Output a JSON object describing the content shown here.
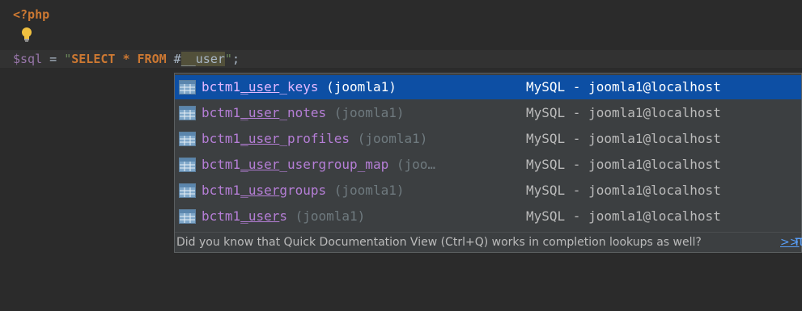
{
  "editor": {
    "line1": {
      "open_tag": "<?php"
    },
    "line3": {
      "var": "$sql",
      "eq": " = ",
      "quote_open": "\"",
      "kw_select": "SELECT",
      "star": " * ",
      "kw_from": "FROM",
      "hash": " #",
      "caret_gap": "__",
      "typed": "user",
      "quote_close": "\"",
      "semicolon": ";"
    }
  },
  "completion": {
    "items": [
      {
        "prefix": "bctm1",
        "sep": "_",
        "match": "user",
        "rest": "_keys",
        "schema": " (joomla1)",
        "source": "MySQL - joomla1@localhost",
        "selected": true
      },
      {
        "prefix": "bctm1",
        "sep": "_",
        "match": "user",
        "rest": "_notes",
        "schema": " (joomla1)",
        "source": "MySQL - joomla1@localhost",
        "selected": false
      },
      {
        "prefix": "bctm1",
        "sep": "_",
        "match": "user",
        "rest": "_profiles",
        "schema": " (joomla1)",
        "source": "MySQL - joomla1@localhost",
        "selected": false
      },
      {
        "prefix": "bctm1",
        "sep": "_",
        "match": "user",
        "rest": "_usergroup_map",
        "schema": " (joo…",
        "source": "MySQL - joomla1@localhost",
        "selected": false
      },
      {
        "prefix": "bctm1",
        "sep": "_",
        "match": "user",
        "rest": "groups",
        "schema": " (joomla1)",
        "source": "MySQL - joomla1@localhost",
        "selected": false
      },
      {
        "prefix": "bctm1",
        "sep": "_",
        "match": "user",
        "rest": "s",
        "schema": " (joomla1)",
        "source": "MySQL - joomla1@localhost",
        "selected": false
      }
    ],
    "tip": {
      "text": "Did you know that Quick Documentation View (Ctrl+Q) works in completion lookups as well?",
      "more_link": ">>",
      "pi": "π"
    },
    "colors": {
      "selected_bg": "#0d4fa4",
      "popup_bg": "#3c3f41",
      "table_name": "#b57ed6"
    },
    "icon": "table-icon"
  }
}
